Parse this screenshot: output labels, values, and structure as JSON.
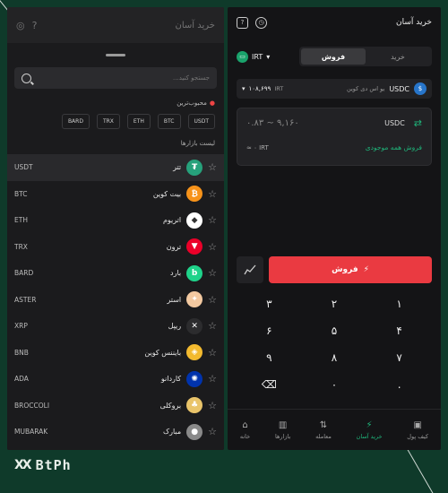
{
  "left": {
    "title": "خرید آسان",
    "search_placeholder": "جستجو کنید...",
    "fav_label": "محبوب‌ترین",
    "chips": [
      "USDT",
      "BTC",
      "ETH",
      "TRX",
      "BARD"
    ],
    "list_label": "لیست بازارها",
    "markets": [
      {
        "sym": "USDT",
        "name": "تتر",
        "color": "#26a17b",
        "glyph": "₮"
      },
      {
        "sym": "BTC",
        "name": "بیت کوین",
        "color": "#f7931a",
        "glyph": "₿"
      },
      {
        "sym": "ETH",
        "name": "اتریوم",
        "color": "#ffffff",
        "glyph": "◆"
      },
      {
        "sym": "TRX",
        "name": "ترون",
        "color": "#eb0029",
        "glyph": "▼"
      },
      {
        "sym": "BARD",
        "name": "بارد",
        "color": "#1fd38a",
        "glyph": "b"
      },
      {
        "sym": "ASTER",
        "name": "استر",
        "color": "#f3c9a1",
        "glyph": "✦"
      },
      {
        "sym": "XRP",
        "name": "ریپل",
        "color": "#2c2c2e",
        "glyph": "✕"
      },
      {
        "sym": "BNB",
        "name": "بایننس کوین",
        "color": "#f3ba2f",
        "glyph": "◈"
      },
      {
        "sym": "ADA",
        "name": "کاردانو",
        "color": "#0033ad",
        "glyph": "✺"
      },
      {
        "sym": "BROCCOLI",
        "name": "بروکلی",
        "color": "#e9c46a",
        "glyph": "♣"
      },
      {
        "sym": "MUBARAK",
        "name": "مبارک",
        "color": "#8a8a8a",
        "glyph": "●"
      }
    ]
  },
  "right": {
    "title": "خرید آسان",
    "currency": "IRT",
    "tabs": {
      "buy": "خرید",
      "sell": "فروش"
    },
    "asset": {
      "code": "USDC",
      "name": "یو اس دی کوین",
      "amount": "۱۰۸,۶۹۹",
      "unit": "IRT"
    },
    "amount_range": "۰.۸۳ ~ ۹,۱۶۰",
    "amount_code": "USDC",
    "irt_value": "≈ ۰ IRT",
    "sell_all": "فروش همه موجودی",
    "sell_button": "فروش",
    "keys": [
      "۳",
      "۲",
      "۱",
      "۶",
      "۵",
      "۴",
      "۹",
      "۸",
      "۷",
      "⌫",
      "۰",
      "."
    ],
    "nav": [
      {
        "label": "خانه",
        "icon": "⌂"
      },
      {
        "label": "بازارها",
        "icon": "▥"
      },
      {
        "label": "معامله",
        "icon": "⇅"
      },
      {
        "label": "خرید آسان",
        "icon": "⚡",
        "active": true
      },
      {
        "label": "کیف پول",
        "icon": "▣"
      }
    ]
  },
  "brand": {
    "name": "BtPh",
    "mark": "XX"
  }
}
